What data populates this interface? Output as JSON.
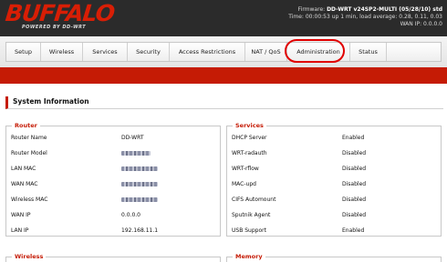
{
  "brand": {
    "logo_text": "BUFFALO",
    "tagline": "POWERED BY DD-WRT"
  },
  "sysinfo": {
    "firmware_label": "Firmware: ",
    "firmware_value": "DD-WRT v24SP2-MULTI (05/28/10) std",
    "time_label": "Time: ",
    "time_value": "00:00:53 up 1 min, load average: 0.28, 0.11, 0.03",
    "wan_label": "WAN IP: ",
    "wan_value": "0.0.0.0"
  },
  "tabs": [
    {
      "label": "Setup"
    },
    {
      "label": "Wireless"
    },
    {
      "label": "Services"
    },
    {
      "label": "Security"
    },
    {
      "label": "Access Restrictions"
    },
    {
      "label": "NAT / QoS"
    },
    {
      "label": "Administration",
      "highlighted": true
    },
    {
      "label": "Status"
    }
  ],
  "highlight_color": "#e10000",
  "accent_color": "#c51b05",
  "section_title": "System Information",
  "router": {
    "legend": "Router",
    "rows": [
      {
        "key": "Router Name",
        "value": "DD-WRT"
      },
      {
        "key": "Router Model",
        "value": "",
        "redacted": true
      },
      {
        "key": "LAN MAC",
        "value": "",
        "redacted": true
      },
      {
        "key": "WAN MAC",
        "value": "",
        "redacted": true
      },
      {
        "key": "Wireless MAC",
        "value": "",
        "redacted": true
      },
      {
        "key": "WAN IP",
        "value": "0.0.0.0"
      },
      {
        "key": "LAN IP",
        "value": "192.168.11.1"
      }
    ]
  },
  "services": {
    "legend": "Services",
    "rows": [
      {
        "key": "DHCP Server",
        "value": "Enabled"
      },
      {
        "key": "WRT-radauth",
        "value": "Disabled"
      },
      {
        "key": "WRT-rflow",
        "value": "Disabled"
      },
      {
        "key": "MAC-upd",
        "value": "Disabled"
      },
      {
        "key": "CIFS Automount",
        "value": "Disabled"
      },
      {
        "key": "Sputnik Agent",
        "value": "Disabled"
      },
      {
        "key": "USB Support",
        "value": "Enabled"
      }
    ]
  },
  "wireless": {
    "legend": "Wireless"
  },
  "memory": {
    "legend": "Memory"
  }
}
